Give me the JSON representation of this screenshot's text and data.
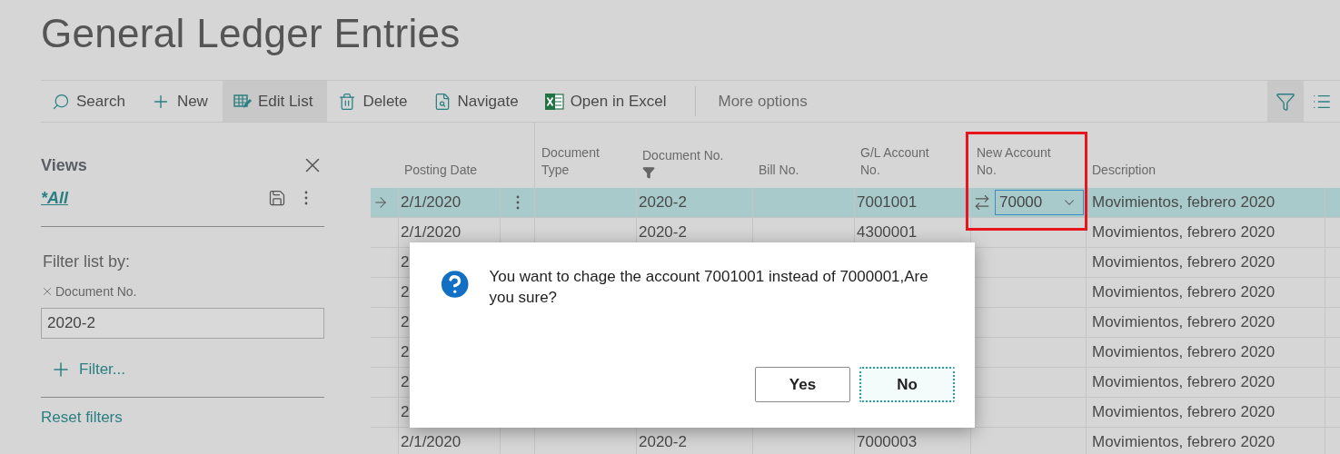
{
  "page": {
    "title": "General Ledger Entries"
  },
  "actions": [
    {
      "kind": "search",
      "label": "Search",
      "selected": false
    },
    {
      "kind": "new",
      "label": "New",
      "selected": false
    },
    {
      "kind": "edit_list",
      "label": "Edit List",
      "selected": true
    },
    {
      "kind": "delete",
      "label": "Delete",
      "selected": false
    },
    {
      "kind": "navigate",
      "label": "Navigate",
      "selected": false
    },
    {
      "kind": "excel",
      "label": "Open in Excel",
      "selected": false
    }
  ],
  "more_options": "More options",
  "view_buttons": [
    {
      "kind": "filter",
      "selected": true
    },
    {
      "kind": "list",
      "selected": false
    }
  ],
  "views_pane": {
    "title": "Views",
    "view": "*All",
    "filter_heading": "Filter list by:",
    "filters": [
      {
        "field": "Document No.",
        "value": "2020-2"
      }
    ],
    "add_filter": "Filter...",
    "reset": "Reset filters"
  },
  "table": {
    "columns": [
      {
        "kind": "marker"
      },
      {
        "kind": "text",
        "label": "Posting Date"
      },
      {
        "kind": "menu"
      },
      {
        "kind": "text",
        "label": "Document Type"
      },
      {
        "kind": "text",
        "label": "Document No.",
        "filtered": true
      },
      {
        "kind": "text",
        "label": "Bill No."
      },
      {
        "kind": "text",
        "label": "G/L Account No."
      },
      {
        "kind": "text",
        "label": "New Account No.",
        "highlighted": true
      },
      {
        "kind": "text",
        "label": "Description"
      },
      {
        "kind": "text"
      }
    ],
    "rows": [
      {
        "selected": true,
        "posting_date": "2/1/2020",
        "document_no": "2020-2",
        "gl_account_no": "7001001",
        "new_account_no": "70000",
        "description": "Movimientos, febrero 2020"
      },
      {
        "selected": false,
        "posting_date": "2/1/2020",
        "document_no": "2020-2",
        "gl_account_no": "4300001",
        "description": "Movimientos, febrero 2020"
      },
      {
        "selected": false,
        "posting_date": "2",
        "description": "Movimientos, febrero 2020"
      },
      {
        "selected": false,
        "posting_date": "2",
        "description": "Movimientos, febrero 2020"
      },
      {
        "selected": false,
        "posting_date": "2",
        "description": "Movimientos, febrero 2020"
      },
      {
        "selected": false,
        "posting_date": "2",
        "description": "Movimientos, febrero 2020"
      },
      {
        "selected": false,
        "posting_date": "2",
        "description": "Movimientos, febrero 2020"
      },
      {
        "selected": false,
        "posting_date": "2",
        "description": "Movimientos, febrero 2020"
      },
      {
        "selected": false,
        "posting_date": "2/1/2020",
        "document_no": "2020-2",
        "gl_account_no": "7000003",
        "description": "Movimientos, febrero 2020"
      }
    ]
  },
  "dialog": {
    "message": "You want to chage the account 7001001 instead of 7000001,Are you sure?",
    "buttons": [
      {
        "label": "Yes",
        "focused": false
      },
      {
        "label": "No",
        "focused": true
      }
    ]
  }
}
